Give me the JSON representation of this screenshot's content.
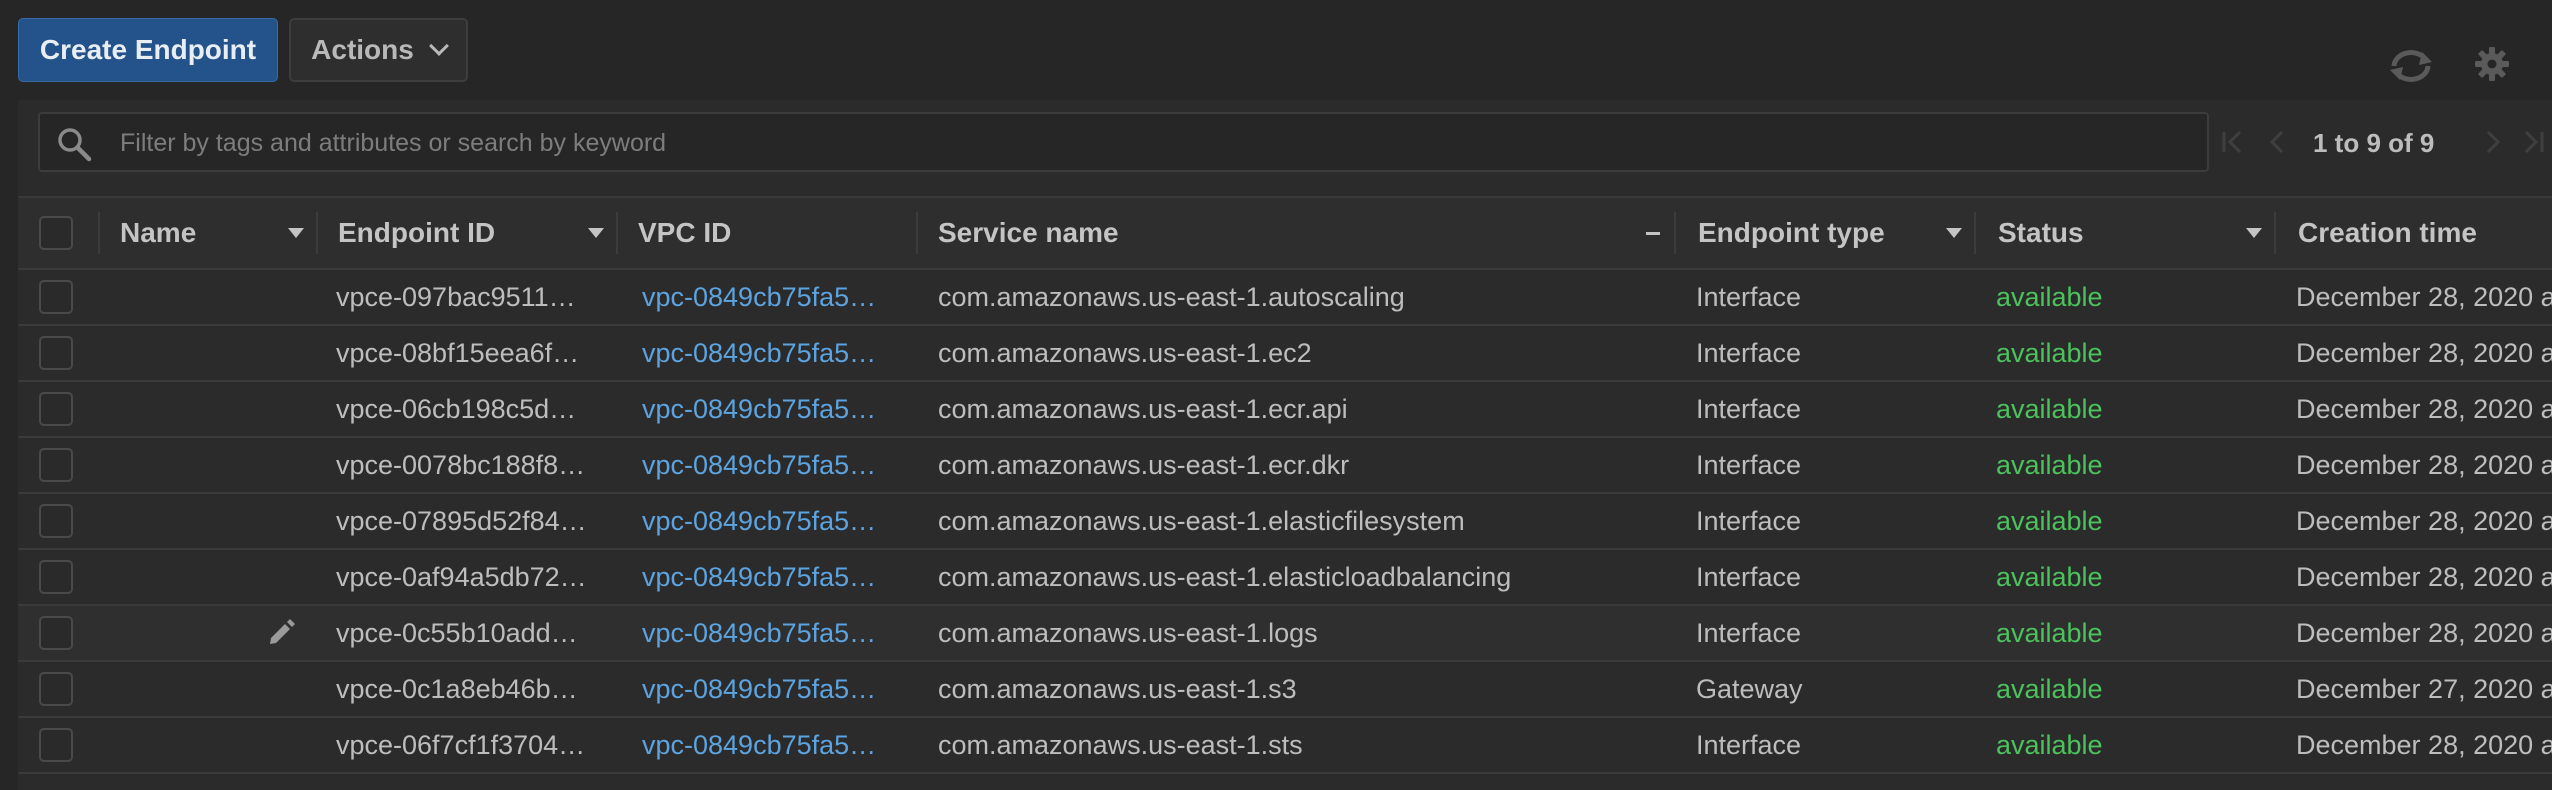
{
  "toolbar": {
    "create_label": "Create Endpoint",
    "actions_label": "Actions"
  },
  "icons": {
    "refresh": "refresh-icon",
    "settings": "gear-icon",
    "search": "search-icon",
    "edit": "pencil-icon"
  },
  "search": {
    "placeholder": "Filter by tags and attributes or search by keyword",
    "value": ""
  },
  "pagination": {
    "text": "1 to 9 of 9"
  },
  "table": {
    "columns": [
      "Name",
      "Endpoint ID",
      "VPC ID",
      "Service name",
      "Endpoint type",
      "Status",
      "Creation time"
    ],
    "rows": [
      {
        "name": "",
        "endpoint_id": "vpce-097bac9511…",
        "vpc_id": "vpc-0849cb75fa5…",
        "service": "com.amazonaws.us-east-1.autoscaling",
        "type": "Interface",
        "status": "available",
        "created": "December 28, 2020 a"
      },
      {
        "name": "",
        "endpoint_id": "vpce-08bf15eea6f…",
        "vpc_id": "vpc-0849cb75fa5…",
        "service": "com.amazonaws.us-east-1.ec2",
        "type": "Interface",
        "status": "available",
        "created": "December 28, 2020 a"
      },
      {
        "name": "",
        "endpoint_id": "vpce-06cb198c5d…",
        "vpc_id": "vpc-0849cb75fa5…",
        "service": "com.amazonaws.us-east-1.ecr.api",
        "type": "Interface",
        "status": "available",
        "created": "December 28, 2020 a"
      },
      {
        "name": "",
        "endpoint_id": "vpce-0078bc188f8…",
        "vpc_id": "vpc-0849cb75fa5…",
        "service": "com.amazonaws.us-east-1.ecr.dkr",
        "type": "Interface",
        "status": "available",
        "created": "December 28, 2020 a"
      },
      {
        "name": "",
        "endpoint_id": "vpce-07895d52f84…",
        "vpc_id": "vpc-0849cb75fa5…",
        "service": "com.amazonaws.us-east-1.elasticfilesystem",
        "type": "Interface",
        "status": "available",
        "created": "December 28, 2020 a"
      },
      {
        "name": "",
        "endpoint_id": "vpce-0af94a5db72…",
        "vpc_id": "vpc-0849cb75fa5…",
        "service": "com.amazonaws.us-east-1.elasticloadbalancing",
        "type": "Interface",
        "status": "available",
        "created": "December 28, 2020 a"
      },
      {
        "name": "",
        "endpoint_id": "vpce-0c55b10add…",
        "vpc_id": "vpc-0849cb75fa5…",
        "service": "com.amazonaws.us-east-1.logs",
        "type": "Interface",
        "status": "available",
        "created": "December 28, 2020 a",
        "editable": true
      },
      {
        "name": "",
        "endpoint_id": "vpce-0c1a8eb46b…",
        "vpc_id": "vpc-0849cb75fa5…",
        "service": "com.amazonaws.us-east-1.s3",
        "type": "Gateway",
        "status": "available",
        "created": "December 27, 2020 a"
      },
      {
        "name": "",
        "endpoint_id": "vpce-06f7cf1f3704…",
        "vpc_id": "vpc-0849cb75fa5…",
        "service": "com.amazonaws.us-east-1.sts",
        "type": "Interface",
        "status": "available",
        "created": "December 28, 2020 a"
      }
    ]
  },
  "colors": {
    "background": "#262626",
    "primary_button": "#24528a",
    "link": "#5da3df",
    "status_available": "#4cc25c"
  }
}
